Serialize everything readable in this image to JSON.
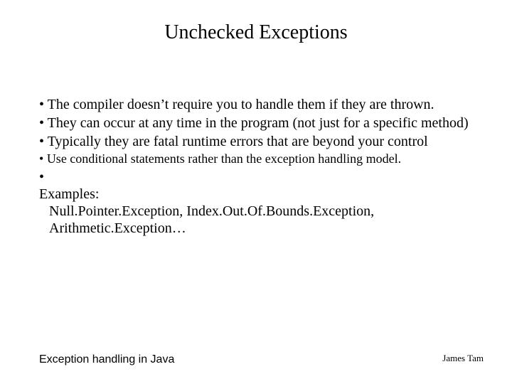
{
  "title": "Unchecked Exceptions",
  "bullets": {
    "b1": "The compiler doesn’t require you to handle them if they are thrown.",
    "b2": "They can occur at any time in the program (not just for a specific method)",
    "b3": "Typically they are fatal runtime errors that are beyond your control",
    "sub1": "Use conditional statements rather than the exception handling model.",
    "b4_line1": "Examples:",
    "b4_line2": "Null.Pointer.Exception, Index.Out.Of.Bounds.Exception, Arithmetic.Exception…"
  },
  "footer": {
    "left": "Exception handling in Java",
    "right": "James Tam"
  }
}
